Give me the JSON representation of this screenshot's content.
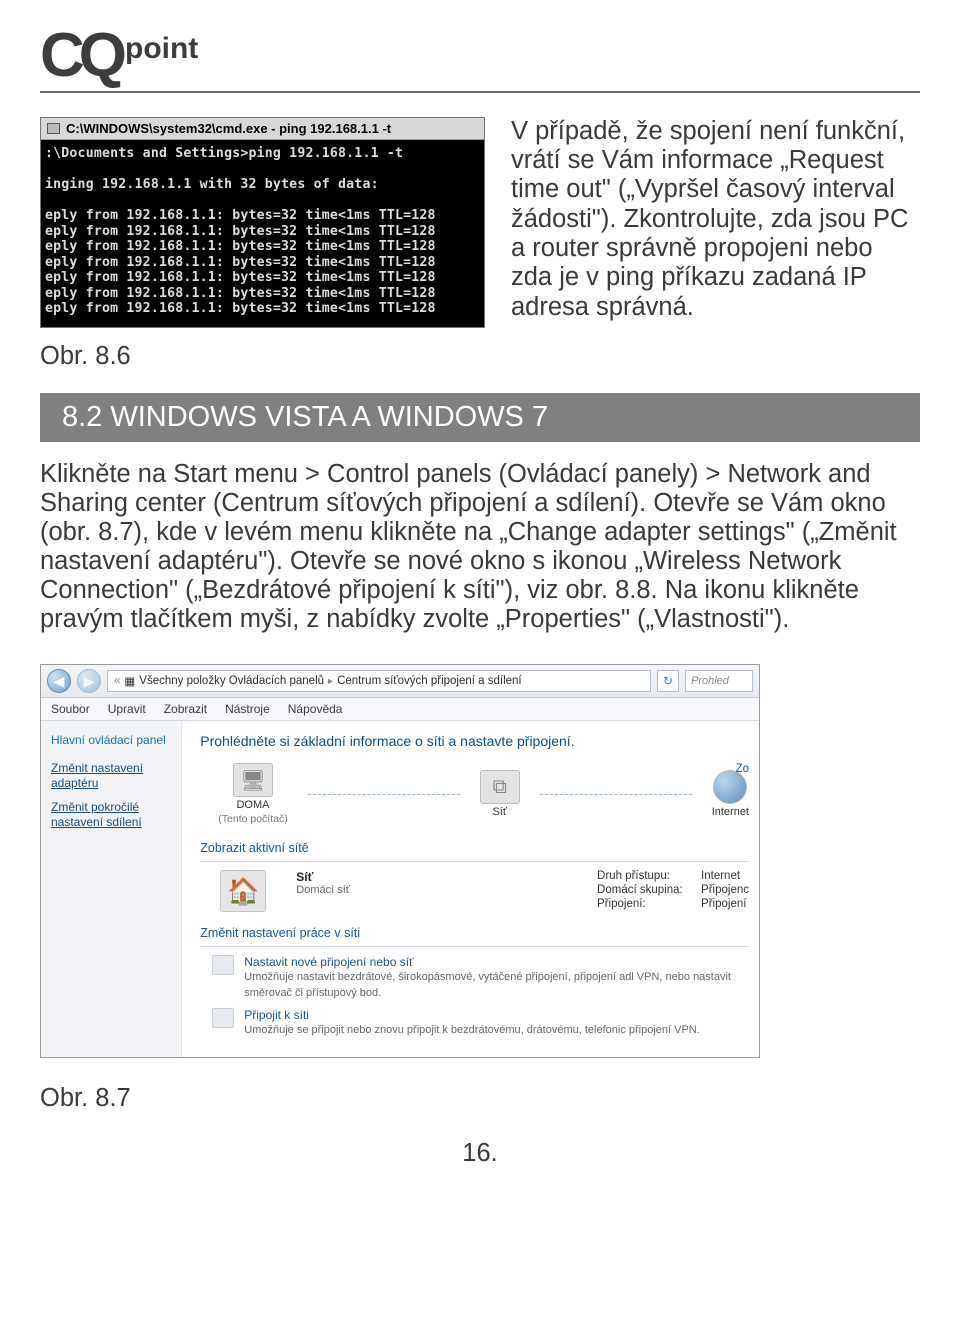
{
  "logo": {
    "left": "CQ",
    "right": "point"
  },
  "cmd": {
    "title": "C:\\WINDOWS\\system32\\cmd.exe - ping 192.168.1.1 -t",
    "lines": [
      ":\\Documents and Settings>ping 192.168.1.1 -t",
      "",
      "inging 192.168.1.1 with 32 bytes of data:",
      "",
      "eply from 192.168.1.1: bytes=32 time<1ms TTL=128",
      "eply from 192.168.1.1: bytes=32 time<1ms TTL=128",
      "eply from 192.168.1.1: bytes=32 time<1ms TTL=128",
      "eply from 192.168.1.1: bytes=32 time<1ms TTL=128",
      "eply from 192.168.1.1: bytes=32 time<1ms TTL=128",
      "eply from 192.168.1.1: bytes=32 time<1ms TTL=128",
      "eply from 192.168.1.1: bytes=32 time<1ms TTL=128"
    ]
  },
  "para1": "V případě, že spojení není funkční, vrátí se Vám informace „Request time out\" („Vypršel časový interval žádosti\"). Zkontrolujte, zda jsou PC a router správně propojeni nebo zda je v ping příkazu zadaná IP adresa správná.",
  "fig1": "Obr. 8.6",
  "section": "8.2 WINDOWS VISTA A WINDOWS 7",
  "para2": "Klikněte na Start menu > Control panels (Ovládací panely) > Network and Sharing center (Centrum síťových připojení a sdílení). Otevře se Vám okno (obr. 8.7), kde v levém menu klikněte na „Change adapter settings\" („Změnit nastavení adaptéru\"). Otevře se nové okno s ikonou „Wireless Network Connection\" („Bezdrátové připojení k síti\"), viz obr. 8.8. Na ikonu klikněte pravým tlačítkem myši, z nabídky zvolte „Properties\" („Vlastnosti\").",
  "win7": {
    "address": {
      "crumb1": "Všechny položky Ovládacích panelů",
      "crumb2": "Centrum síťových připojení a sdílení"
    },
    "search_placeholder": "Prohled",
    "menu": [
      "Soubor",
      "Upravit",
      "Zobrazit",
      "Nástroje",
      "Nápověda"
    ],
    "sidebar": {
      "title": "Hlavní ovládací panel",
      "links": [
        "Změnit nastavení adaptéru",
        "Změnit pokročilé nastavení sdílení"
      ]
    },
    "main": {
      "heading": "Prohlédněte si základní informace o síti a nastavte připojení.",
      "view_link": "Zo",
      "nodes": {
        "n1": "DOMA",
        "n1_sub": "(Tento počítač)",
        "n2": "Síť",
        "n3": "Internet"
      },
      "group1": "Zobrazit aktivní sítě",
      "detail": {
        "name": "Síť",
        "sub": "Domácí síť",
        "kv": [
          {
            "k": "Druh přístupu:",
            "v": "Internet"
          },
          {
            "k": "Domácí skupina:",
            "v": "Připojenc"
          },
          {
            "k": "Připojení:",
            "v": "Připojení"
          }
        ]
      },
      "group2": "Změnit nastavení práce v síti",
      "actions": [
        {
          "title": "Nastavit nové připojení nebo síť",
          "desc": "Umožňuje nastavit bezdrátové, širokopásmové, vytáčené připojení, připojení adl VPN, nebo nastavit směrovač či přístupový bod."
        },
        {
          "title": "Připojit k síti",
          "desc": "Umožňuje se připojit nebo znovu připojit k bezdrátovému, drátovému, telefonic připojení VPN."
        }
      ]
    }
  },
  "fig2": "Obr. 8.7",
  "page_number": "16."
}
